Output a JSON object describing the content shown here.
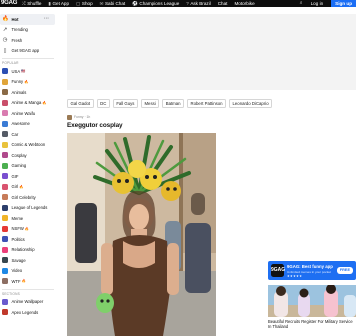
{
  "topbar": {
    "logo": "9GAG",
    "nav": [
      {
        "icon": "shuffle-icon",
        "glyph": "⤮",
        "label": "Shuffle"
      },
      {
        "icon": "app-icon",
        "glyph": "▮",
        "label": "Get App"
      },
      {
        "icon": "shop-icon",
        "glyph": "▢",
        "label": "Shop"
      },
      {
        "icon": "chat-icon",
        "glyph": "✉",
        "label": "Sabi Chat"
      },
      {
        "icon": "trophy-icon",
        "glyph": "⚽",
        "label": "Champions League"
      },
      {
        "icon": "ask-icon",
        "glyph": "?",
        "label": "Ask Brazil"
      },
      {
        "icon": "chat-icon",
        "glyph": "",
        "label": "Chat"
      },
      {
        "icon": "motorbike-icon",
        "glyph": "",
        "label": "Motorbike"
      }
    ],
    "login": "Log in",
    "signup": "Sign up"
  },
  "sidebar": {
    "top": [
      {
        "name": "hot",
        "label": "Hot",
        "glyph": "🔥",
        "active": true
      },
      {
        "name": "trending",
        "label": "Trending",
        "glyph": "↗"
      },
      {
        "name": "fresh",
        "label": "Fresh",
        "glyph": "◷"
      },
      {
        "name": "get-app",
        "label": "Get 9GAG app",
        "glyph": "▯"
      }
    ],
    "section_popular": "POPULAR",
    "popular": [
      {
        "label": "USA",
        "color": "#2b4fb3",
        "fire": false,
        "flag": "🇺🇸"
      },
      {
        "label": "Funny",
        "color": "#e0a53a",
        "fire": true
      },
      {
        "label": "Animals",
        "color": "#8a6a46",
        "fire": false
      },
      {
        "label": "Anime & Manga",
        "color": "#c94f6a",
        "fire": true
      },
      {
        "label": "Anime Waifu",
        "color": "#d97bb0",
        "fire": false
      },
      {
        "label": "Awesome",
        "color": "#3a7bd5",
        "fire": false
      },
      {
        "label": "Car",
        "color": "#555b66",
        "fire": false
      },
      {
        "label": "Comic & Webtoon",
        "color": "#e9c23c",
        "fire": false
      },
      {
        "label": "Cosplay",
        "color": "#b04a8c",
        "fire": false
      },
      {
        "label": "Gaming",
        "color": "#4caf50",
        "fire": false
      },
      {
        "label": "GIF",
        "color": "#7a4fd0",
        "fire": false
      },
      {
        "label": "Girl",
        "color": "#d9536f",
        "fire": true
      },
      {
        "label": "Girl Celebrity",
        "color": "#c77b59",
        "fire": false
      },
      {
        "label": "League of Legends",
        "color": "#2c3e6b",
        "fire": false
      },
      {
        "label": "Meme",
        "color": "#f0b429",
        "fire": false
      },
      {
        "label": "NSFW",
        "color": "#e53935",
        "fire": true
      },
      {
        "label": "Politics",
        "color": "#3f51b5",
        "fire": false
      },
      {
        "label": "Relationship",
        "color": "#ec407a",
        "fire": false
      },
      {
        "label": "Savage",
        "color": "#37474f",
        "fire": false
      },
      {
        "label": "Video",
        "color": "#1e88e5",
        "fire": false
      },
      {
        "label": "WTF",
        "color": "#8d6e63",
        "fire": true
      }
    ],
    "section_sections": "SECTIONS",
    "sections": [
      {
        "label": "Anime Wallpaper",
        "color": "#6a5acd",
        "fire": false
      },
      {
        "label": "Apex Legends",
        "color": "#c0392b",
        "fire": false
      }
    ]
  },
  "tags": [
    "Gal Gadot",
    "DC",
    "Fall Guys",
    "Messi",
    "Batman",
    "Robert Pattinson",
    "Leonardo DiCaprio"
  ],
  "post": {
    "section": "Funny",
    "time": "· 1h",
    "title": "Exeggutor cosplay"
  },
  "app_banner": {
    "title": "9GAG: Best funny app",
    "subtitle": "Unlimited memes in your pocket",
    "stars": "★★★★★",
    "cta": "FREE",
    "icon_text": "9GAG"
  },
  "recommendation": {
    "title": "Beautiful Recruits Register For Military Service In Thailand"
  }
}
